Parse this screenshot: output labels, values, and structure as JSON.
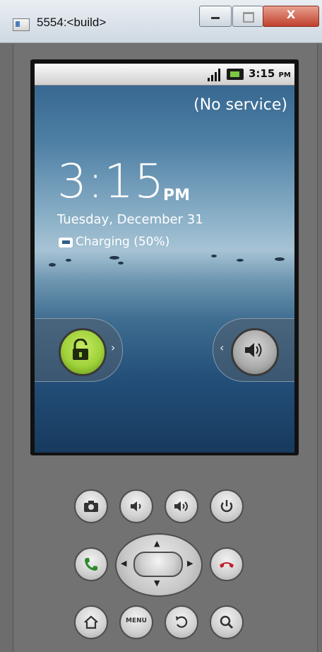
{
  "window": {
    "title": "5554:<build>",
    "minimize_glyph": "",
    "close_glyph": "X"
  },
  "status_bar": {
    "time": "3:15",
    "ampm": "PM"
  },
  "lockscreen": {
    "carrier": "(No service)",
    "clock_time": "3:15",
    "clock_ampm": "PM",
    "date": "Tuesday, December 31",
    "charging": "Charging (50%)"
  },
  "hardware": {
    "menu_label": "MENU"
  },
  "colors": {
    "unlock_green": "#9fd23a",
    "call_green": "#2a8a2a",
    "end_red": "#c0202a",
    "screen_blue": "#2f5f8a"
  },
  "icons": [
    "signal-icon",
    "battery-charging-icon",
    "unlock-icon",
    "sound-icon",
    "camera-icon",
    "volume-down-icon",
    "volume-up-icon",
    "power-icon",
    "call-icon",
    "end-call-icon",
    "home-icon",
    "back-icon",
    "search-icon"
  ]
}
